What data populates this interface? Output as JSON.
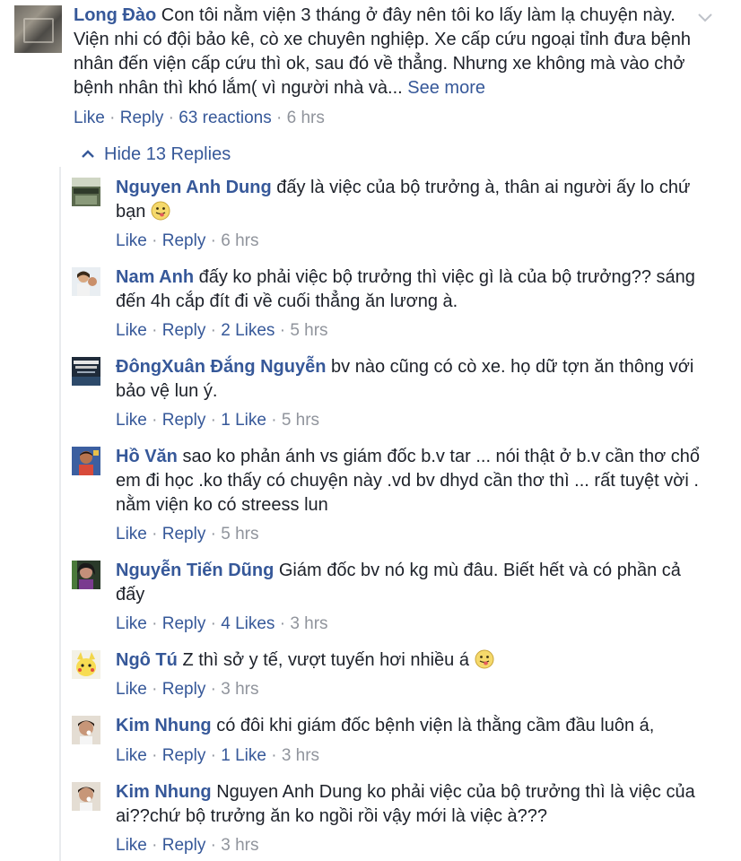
{
  "top_comment": {
    "author": "Long Đào",
    "text": "Con tôi nằm viện 3 tháng ở đây nên tôi ko lấy làm lạ chuyện này. Viện nhi có đội bảo kê, cò xe chuyên nghiệp. Xe cấp cứu ngoại tỉnh đưa bệnh nhân đến viện cấp cứu thì ok, sau đó về thẳng. Nhưng xe không mà vào chở bệnh nhân thì khó lắm( vì người nhà và...",
    "see_more": "See more",
    "like": "Like",
    "reply": "Reply",
    "reactions": "63 reactions",
    "time": "6 hrs",
    "menu_icon": "chevron-down-icon"
  },
  "hide_replies": "Hide 13 Replies",
  "colors": {
    "link": "#365899",
    "meta": "#90949c",
    "text": "#1d2129",
    "thread_line": "#e9ebee"
  },
  "replies": [
    {
      "author": "Nguyen Anh Dung",
      "text": "đấy là việc của bộ trưởng à, thân ai người ấy lo chứ bạn",
      "emoji": "tongue-out-emoji",
      "like": "Like",
      "reply": "Reply",
      "likes": "",
      "time": "6 hrs"
    },
    {
      "author": "Nam Anh",
      "text": "đấy ko phải việc bộ trưởng thì việc gì là của bộ trưởng?? sáng đến 4h cắp đít đi về cuối thẳng ăn lương à.",
      "like": "Like",
      "reply": "Reply",
      "likes": "2 Likes",
      "time": "5 hrs"
    },
    {
      "author": "ĐôngXuân Đắng Nguyễn",
      "text": "bv nào cũng có cò xe. họ dữ tợn ăn thông với bảo vệ lun ý.",
      "like": "Like",
      "reply": "Reply",
      "likes": "1 Like",
      "time": "5 hrs"
    },
    {
      "author": "Hồ Văn",
      "text": "sao ko phản ánh vs giám đốc b.v tar ... nói thật ở b.v cần thơ chổ em đi học .ko thấy có chuyện này .vd bv dhyd cần thơ thì ... rất tuyệt vời . nằm viện ko có streess lun",
      "like": "Like",
      "reply": "Reply",
      "likes": "",
      "time": "5 hrs"
    },
    {
      "author": "Nguyễn Tiến Dũng",
      "text": "Giám đốc bv nó kg mù đâu. Biết hết và có phần cả đấy",
      "like": "Like",
      "reply": "Reply",
      "likes": "4 Likes",
      "time": "3 hrs"
    },
    {
      "author": "Ngô Tú",
      "text": "Z thì sở y tế, vượt tuyến hơi nhiều á",
      "emoji": "tongue-out-emoji",
      "like": "Like",
      "reply": "Reply",
      "likes": "",
      "time": "3 hrs"
    },
    {
      "author": "Kim Nhung",
      "text": "có đôi khi giám đốc bệnh viện là thằng cầm đầu luôn á,",
      "like": "Like",
      "reply": "Reply",
      "likes": "1 Like",
      "time": "3 hrs"
    },
    {
      "author": "Kim Nhung",
      "text": "Nguyen Anh Dung ko phải việc của bộ trưởng thì là việc của ai??chứ bộ trưởng ăn ko ngồi rồi vậy mới là việc à???",
      "like": "Like",
      "reply": "Reply",
      "likes": "",
      "time": "3 hrs"
    }
  ]
}
